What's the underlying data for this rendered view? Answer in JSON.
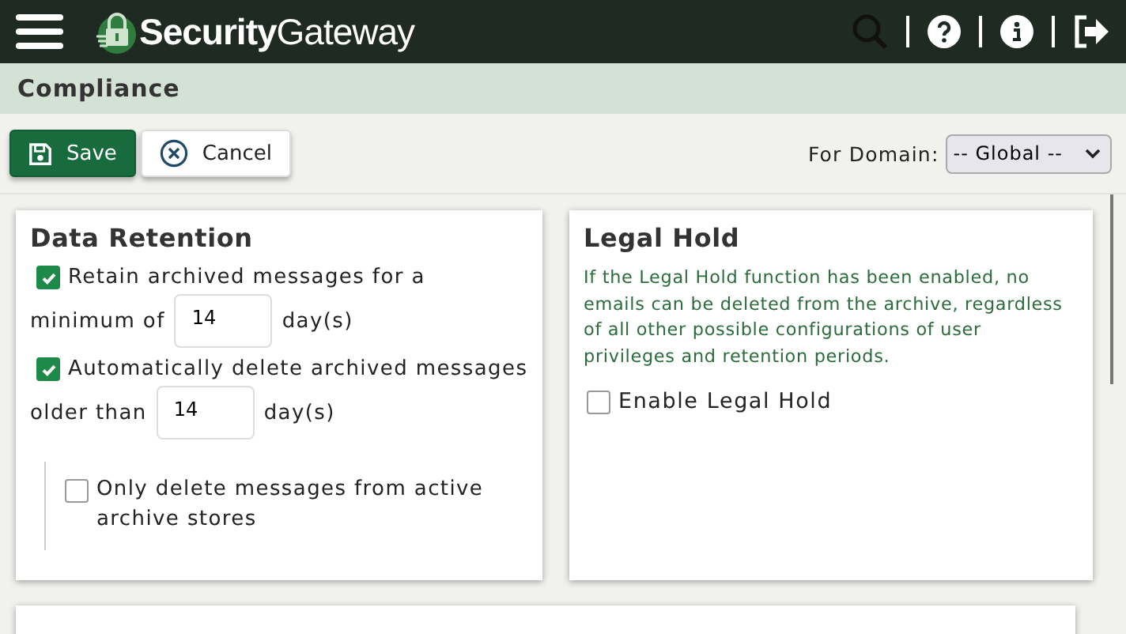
{
  "header": {
    "brand": "Security",
    "brand_suffix": "Gateway"
  },
  "page_title": "Compliance",
  "toolbar": {
    "buttons": [
      {
        "label": "Save",
        "kind": "primary"
      },
      {
        "label": "Cancel",
        "kind": "secondary"
      }
    ],
    "domain_label": "For Domain:",
    "domain_value": "-- Global --"
  },
  "data_retention": {
    "title": "Data Retention",
    "retain": {
      "label": "Retain archived messages for a",
      "checked": true,
      "prefix": "minimum of",
      "value": "14",
      "suffix": "day(s)"
    },
    "auto_delete": {
      "label": "Automatically delete archived messages",
      "checked": true,
      "prefix": "older than",
      "value": "14",
      "suffix": "day(s)"
    },
    "active_only": {
      "label": "Only delete messages from active archive stores",
      "checked": false
    }
  },
  "legal_hold": {
    "title": "Legal Hold",
    "description": "If the Legal Hold function has been enabled, no emails can be deleted from the archive, regardless of all other possible configurations of user privileges and retention periods.",
    "enable": {
      "label": "Enable Legal Hold",
      "checked": false
    }
  }
}
